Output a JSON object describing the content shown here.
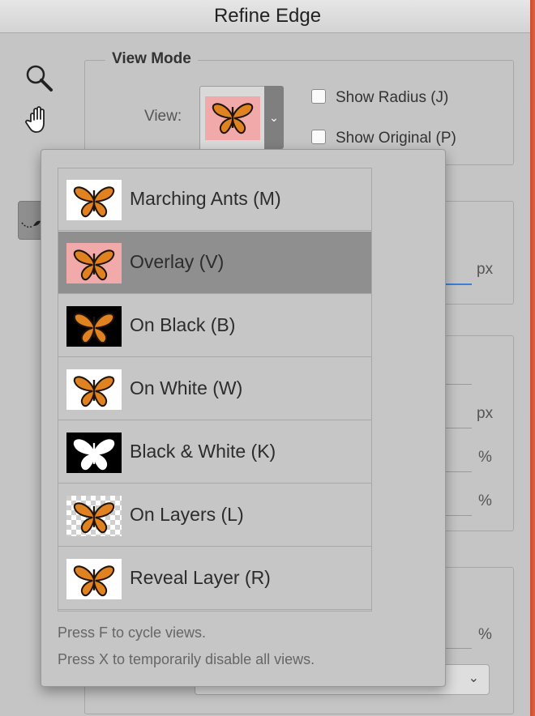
{
  "window": {
    "title": "Refine Edge"
  },
  "tools": [
    {
      "name": "zoom-tool",
      "icon": "magnifier-icon"
    },
    {
      "name": "hand-tool",
      "icon": "hand-icon"
    },
    {
      "name": "refine-radius-tool",
      "icon": "brush-icon"
    }
  ],
  "view_mode": {
    "legend": "View Mode",
    "view_label": "View:",
    "selected_view": "Overlay (V)",
    "show_radius": {
      "label": "Show Radius (J)",
      "checked": false
    },
    "show_original": {
      "label": "Show Original (P)",
      "checked": false
    }
  },
  "background_units": {
    "u1": "px",
    "u2": "px",
    "u3": "%",
    "u4": "%",
    "u5": "%"
  },
  "dropdown": {
    "items": [
      {
        "label": "Marching Ants (M)",
        "bg": "#ffffff",
        "butterfly": "orange",
        "selected": false
      },
      {
        "label": "Overlay (V)",
        "bg": "#f1a9a9",
        "butterfly": "orange",
        "selected": true
      },
      {
        "label": "On Black (B)",
        "bg": "#000000",
        "butterfly": "orange",
        "selected": false
      },
      {
        "label": "On White (W)",
        "bg": "#ffffff",
        "butterfly": "orange",
        "selected": false
      },
      {
        "label": "Black & White (K)",
        "bg": "#000000",
        "butterfly": "white",
        "selected": false
      },
      {
        "label": "On Layers (L)",
        "bg": "checker",
        "butterfly": "orange",
        "selected": false
      },
      {
        "label": "Reveal Layer (R)",
        "bg": "#ffffff",
        "butterfly": "orange",
        "selected": false
      }
    ],
    "hint_cycle": "Press F to cycle views.",
    "hint_disable": "Press X to temporarily disable all views."
  },
  "colors": {
    "butterfly_orange": "#e0821f",
    "butterfly_dark": "#1f140c",
    "overlay_pink": "#f1a9a9"
  }
}
